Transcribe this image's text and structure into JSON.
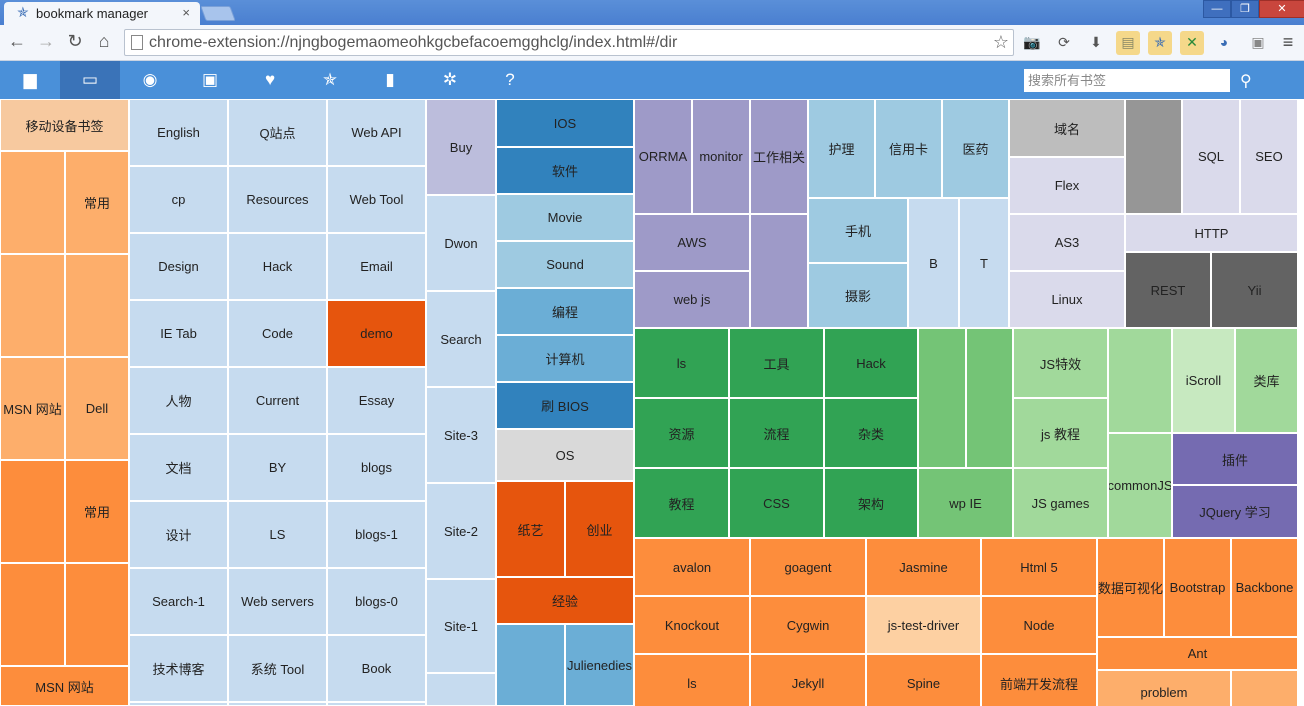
{
  "browser": {
    "tab_title": "bookmark manager",
    "tab_close": "×",
    "url": "chrome-extension://njngbogemaomeohkgcbefacoemgghclg/index.html#/dir",
    "window_controls": [
      "—",
      "❐",
      "✕"
    ]
  },
  "app_nav": {
    "icons": [
      "folder-solid-icon",
      "folder-open-icon",
      "eye-icon",
      "calendar-check-icon",
      "heart-icon",
      "star-icon",
      "trash-icon",
      "gear-icon",
      "question-icon"
    ],
    "search_placeholder": "搜索所有书签"
  },
  "colors": {
    "nav_bg": "#4a90d9",
    "nav_active": "#3a73b8",
    "orange": "#fd8d3c",
    "burnt_orange": "#e6550d",
    "blue": "#3182bd",
    "green": "#31a354",
    "purple": "#756bb1"
  },
  "treemap": {
    "cells": [
      "移动设备书签",
      "常用",
      "MSN 网站",
      "Dell",
      "常用",
      "MSN 网站",
      "English",
      "Q站点",
      "Web API",
      "cp",
      "Resources",
      "Web Tool",
      "Design",
      "Hack",
      "Email",
      "IE Tab",
      "Code",
      "demo",
      "人物",
      "Current",
      "Essay",
      "文档",
      "BY",
      "blogs",
      "设计",
      "LS",
      "blogs-1",
      "Search-1",
      "Web servers",
      "blogs-0",
      "技术博客",
      "系统 Tool",
      "Book",
      "Buy",
      "Dwon",
      "Search",
      "Site-3",
      "Site-2",
      "Site-1",
      "IOS",
      "软件",
      "Movie",
      "Sound",
      "编程",
      "计算机",
      "刷 BIOS",
      "OS",
      "纸艺",
      "创业",
      "经验",
      "Julienedies",
      "ORRMA",
      "monitor",
      "工作相关",
      "AWS",
      "web js",
      "护理",
      "信用卡",
      "医药",
      "手机",
      "摄影",
      "B",
      "T",
      "域名",
      "Flex",
      "AS3",
      "Linux",
      "SQL",
      "SEO",
      "HTTP",
      "REST",
      "Yii",
      "ls",
      "工具",
      "Hack",
      "资源",
      "流程",
      "杂类",
      "教程",
      "CSS",
      "架构",
      "wp IE",
      "JS特效",
      "js 教程",
      "JS games",
      "commonJS",
      "iScroll",
      "类库",
      "插件",
      "JQuery 学习",
      "avalon",
      "goagent",
      "Jasmine",
      "Html 5",
      "数据可视化",
      "Bootstrap",
      "Backbone",
      "Knockout",
      "Cygwin",
      "js-test-driver",
      "Node",
      "Ant",
      "ls",
      "Jekyll",
      "Spine",
      "前端开发流程",
      "problem"
    ]
  }
}
